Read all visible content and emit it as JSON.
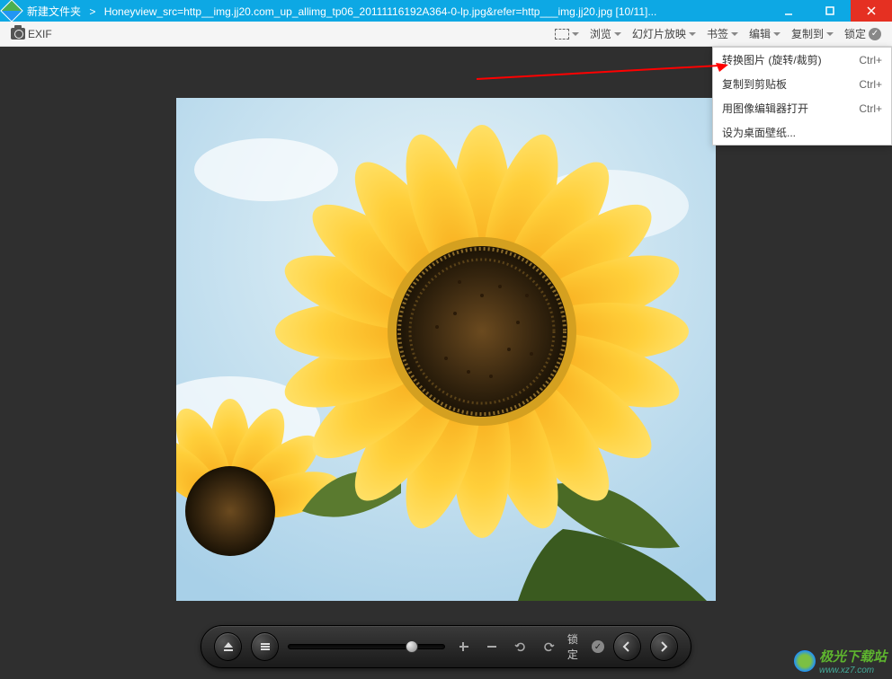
{
  "titlebar": {
    "folder": "新建文件夹",
    "filename": "Honeyview_src=http__img.jj20.com_up_allimg_tp06_20111116192A364-0-lp.jpg&refer=http___img.jj20.jpg [10/11]..."
  },
  "toolbar": {
    "exif": "EXIF",
    "browse": "浏览",
    "slideshow": "幻灯片放映",
    "bookmark": "书签",
    "edit": "编辑",
    "copyto": "复制到",
    "lock": "锁定"
  },
  "menu": {
    "items": [
      {
        "label": "转换图片 (旋转/裁剪)",
        "shortcut": "Ctrl+"
      },
      {
        "label": "复制到剪贴板",
        "shortcut": "Ctrl+"
      },
      {
        "label": "用图像编辑器打开",
        "shortcut": "Ctrl+"
      },
      {
        "label": "设为桌面壁纸...",
        "shortcut": ""
      }
    ]
  },
  "bottom": {
    "lock": "锁定"
  },
  "watermark": {
    "main": "极光下载站",
    "sub": "www.xz7.com"
  }
}
